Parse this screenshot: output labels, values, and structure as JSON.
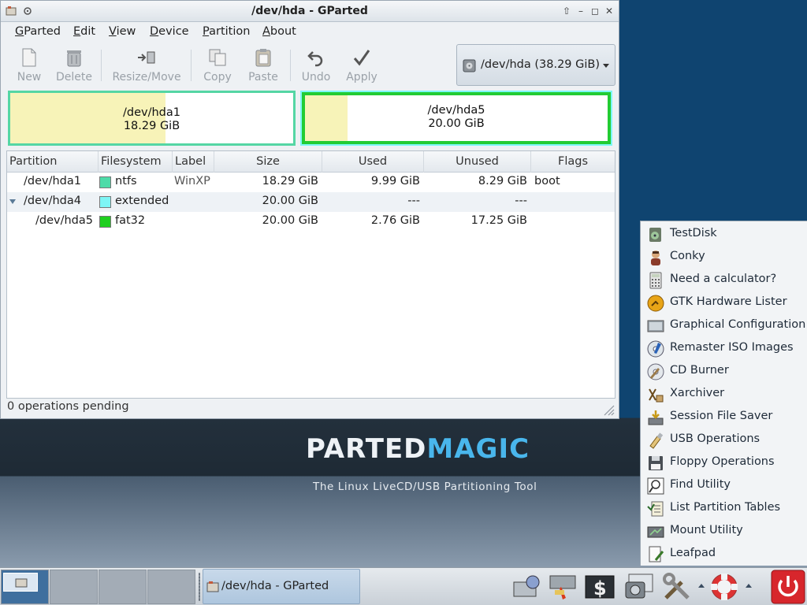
{
  "window": {
    "title": "/dev/hda - GParted",
    "menus": [
      {
        "pre": "",
        "u": "G",
        "post": "Parted"
      },
      {
        "pre": "",
        "u": "E",
        "post": "dit"
      },
      {
        "pre": "",
        "u": "V",
        "post": "iew"
      },
      {
        "pre": "",
        "u": "D",
        "post": "evice"
      },
      {
        "pre": "",
        "u": "P",
        "post": "artition"
      },
      {
        "pre": "",
        "u": "A",
        "post": "bout"
      }
    ],
    "toolbar": {
      "new": "New",
      "delete": "Delete",
      "resize_move": "Resize/Move",
      "copy": "Copy",
      "paste": "Paste",
      "undo": "Undo",
      "apply": "Apply"
    },
    "device_selector": "/dev/hda  (38.29 GiB)",
    "status": "0 operations pending"
  },
  "partition_bar": [
    {
      "name": "/dev/hda1",
      "size": "18.29 GiB",
      "used_fraction": 0.55,
      "fs_color": "#55d6a4"
    },
    {
      "name": "/dev/hda5",
      "size": "20.00 GiB",
      "used_fraction": 0.14,
      "fs_color": "#22cc33",
      "extended_color": "#7df7f7"
    }
  ],
  "table": {
    "headers": [
      "Partition",
      "Filesystem",
      "Label",
      "Size",
      "Used",
      "Unused",
      "Flags"
    ],
    "rows": [
      {
        "partition": "/dev/hda1",
        "filesystem": "ntfs",
        "fs_color": "#4ddba8",
        "label": "WinXP",
        "size": "18.29 GiB",
        "used": "9.99 GiB",
        "unused": "8.29 GiB",
        "flags": "boot"
      },
      {
        "partition": "/dev/hda4",
        "filesystem": "extended",
        "fs_color": "#7ef5f5",
        "label": "",
        "size": "20.00 GiB",
        "used": "---",
        "unused": "---",
        "flags": ""
      },
      {
        "partition": "/dev/hda5",
        "filesystem": "fat32",
        "fs_color": "#1fcf1f",
        "label": "",
        "size": "20.00 GiB",
        "used": "2.76 GiB",
        "unused": "17.25 GiB",
        "flags": ""
      }
    ]
  },
  "desktop": {
    "logo_part1": "PARTED",
    "logo_part2": "MAGIC",
    "tagline": "The Linux LiveCD/USB Partitioning Tool"
  },
  "app_menu": [
    {
      "label": "TestDisk",
      "icon": "testdisk-icon"
    },
    {
      "label": "Conky",
      "icon": "conky-icon"
    },
    {
      "label": "Need a calculator?",
      "icon": "calculator-icon"
    },
    {
      "label": "GTK Hardware Lister",
      "icon": "hardware-lister-icon"
    },
    {
      "label": "Graphical Configuration",
      "icon": "display-config-icon"
    },
    {
      "label": "Remaster ISO Images",
      "icon": "remaster-icon"
    },
    {
      "label": "CD Burner",
      "icon": "cd-burner-icon"
    },
    {
      "label": "Xarchiver",
      "icon": "archiver-icon"
    },
    {
      "label": "Session File Saver",
      "icon": "session-saver-icon"
    },
    {
      "label": "USB Operations",
      "icon": "usb-icon"
    },
    {
      "label": "Floppy Operations",
      "icon": "floppy-icon"
    },
    {
      "label": "Find Utility",
      "icon": "find-icon"
    },
    {
      "label": "List Partition Tables",
      "icon": "list-partition-icon"
    },
    {
      "label": "Mount Utility",
      "icon": "mount-icon"
    },
    {
      "label": "Leafpad",
      "icon": "leafpad-icon"
    }
  ],
  "taskbar": {
    "task_label": "/dev/hda - GParted"
  }
}
